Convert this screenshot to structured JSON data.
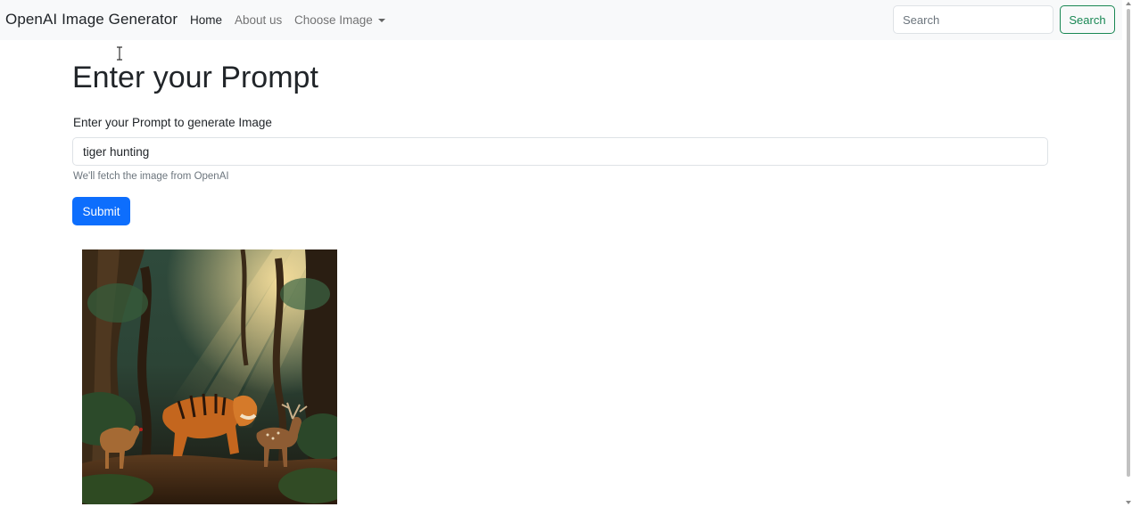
{
  "navbar": {
    "brand": "OpenAI Image Generator",
    "links": [
      {
        "label": "Home",
        "active": true
      },
      {
        "label": "About us",
        "active": false
      },
      {
        "label": "Choose Image",
        "active": false,
        "dropdown": true
      }
    ],
    "search": {
      "placeholder": "Search",
      "value": "",
      "button_label": "Search"
    }
  },
  "main": {
    "heading": "Enter your Prompt",
    "prompt_label": "Enter your Prompt to generate Image",
    "prompt_value": "tiger hunting",
    "help_text": "We'll fetch the image from OpenAI",
    "submit_label": "Submit"
  },
  "result": {
    "image_subject": "tiger hunting deer in sunlit forest"
  },
  "colors": {
    "navbar_bg": "#f8f9fa",
    "primary": "#0d6efd",
    "success": "#198754",
    "muted": "#6c757d"
  }
}
